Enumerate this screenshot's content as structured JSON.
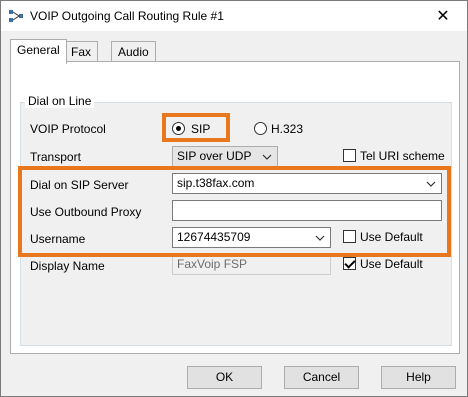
{
  "window": {
    "title": "VOIP Outgoing Call Routing Rule #1",
    "close_glyph": "✕"
  },
  "tabs": [
    {
      "label": "General",
      "active": true
    },
    {
      "label": "Fax",
      "active": false
    },
    {
      "label": "Audio",
      "active": false
    }
  ],
  "group": {
    "label": "Dial on Line"
  },
  "form": {
    "voip_protocol_label": "VOIP Protocol",
    "sip_label": "SIP",
    "h323_label": "H.323",
    "transport_label": "Transport",
    "transport_value": "SIP over UDP",
    "tel_uri_label": "Tel URI scheme",
    "dial_sip_server_label": "Dial on SIP Server",
    "dial_sip_server_value": "sip.t38fax.com",
    "outbound_proxy_label": "Use Outbound Proxy",
    "outbound_proxy_value": "",
    "username_label": "Username",
    "username_value": "12674435709",
    "username_use_default_label": "Use Default",
    "display_name_label": "Display Name",
    "display_name_value": "FaxVoip FSP",
    "display_name_use_default_label": "Use Default"
  },
  "state": {
    "protocol_selected": "SIP",
    "tel_uri_checked": false,
    "username_use_default_checked": false,
    "display_name_use_default_checked": true
  },
  "buttons": {
    "ok": "OK",
    "cancel": "Cancel",
    "help": "Help"
  },
  "colors": {
    "highlight": "#e8771d",
    "window_bg": "#f0f0f0",
    "panel_bg": "#ffffff"
  },
  "icons": {
    "title": "network-routing-icon",
    "close": "close-icon",
    "dropdown": "chevron-down-icon"
  }
}
